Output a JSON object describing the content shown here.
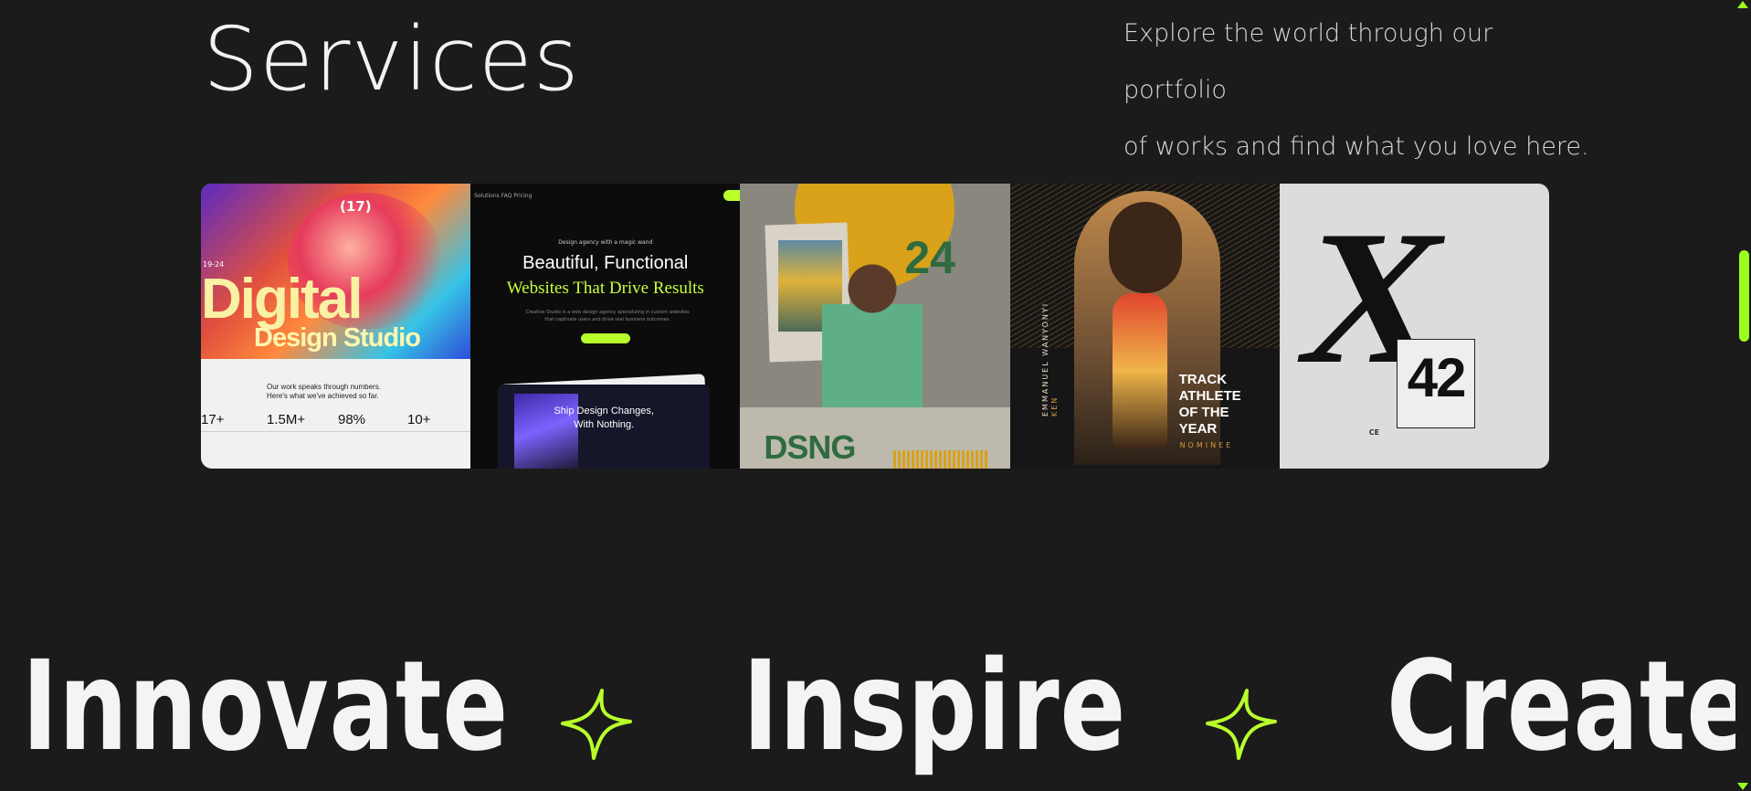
{
  "section": {
    "title": "Services",
    "tagline_line1": "Explore the world through our portfolio",
    "tagline_line2": "of works and find what you love here."
  },
  "gallery": {
    "tile1": {
      "number": "(17)",
      "date": "19-24",
      "headline_big": "Digital",
      "headline_small": "Design Studio",
      "stats_intro": "Our work speaks through numbers. Here's what we've achieved so far.",
      "stats": [
        "17+",
        "1.5M+",
        "98%",
        "10+"
      ]
    },
    "tile2": {
      "nav": "Solutions   FAQ   Pricing",
      "kicker": "Design agency with a magic wand",
      "headline_1": "Beautiful, Functional",
      "headline_2": "Websites That Drive Results",
      "blurb": "Creative Studio is a web design agency specializing in custom websites that captivate users and drive real business outcomes.",
      "card_text_1": "Ship Design Changes,",
      "card_text_2": "With Nothing."
    },
    "tile3": {
      "year": "24",
      "wordmark": "DSNG"
    },
    "tile4": {
      "vertical_name": "EMMANUEL WANYONYI",
      "vertical_country": "KEN",
      "title": "TRACK ATHLETE OF THE YEAR",
      "subtitle": "NOMINEE"
    },
    "tile5": {
      "letter": "X",
      "number": "42",
      "mark": "CE"
    }
  },
  "marquee": {
    "words": [
      "Innovate",
      "Inspire",
      "Create"
    ],
    "accent_color": "#b9ff2a"
  },
  "colors": {
    "background": "#1b1b1b",
    "accent": "#9bff1f"
  }
}
